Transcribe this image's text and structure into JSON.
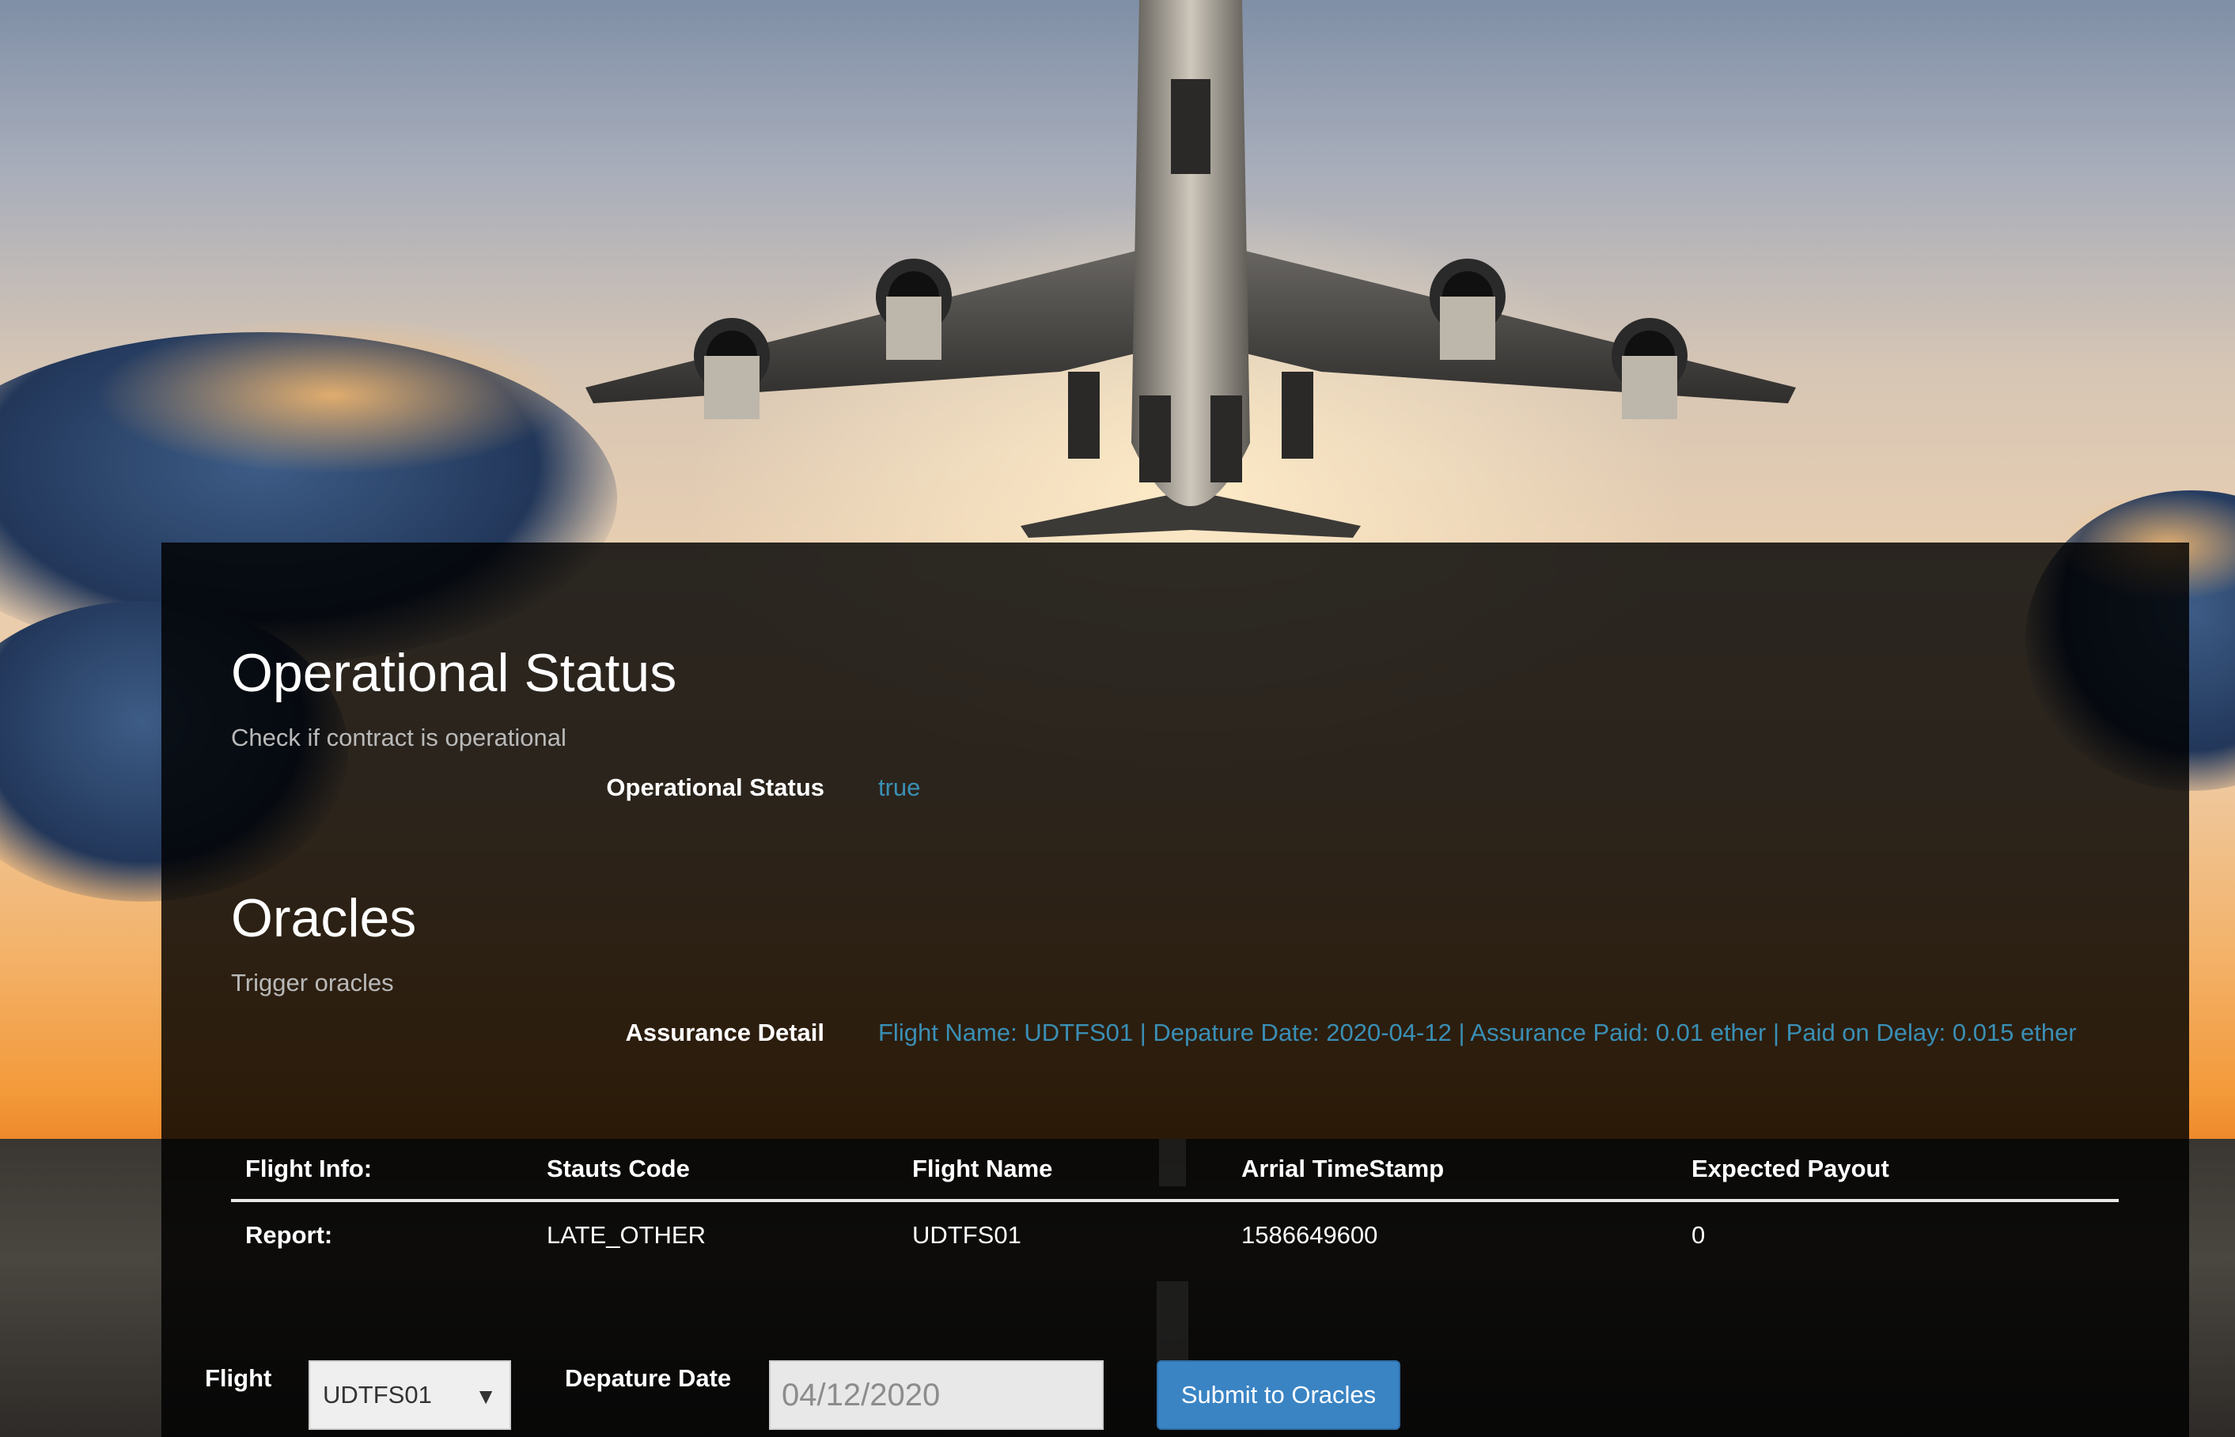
{
  "operational": {
    "title": "Operational Status",
    "subtitle": "Check if contract is operational",
    "label": "Operational Status",
    "value": "true"
  },
  "oracles": {
    "title": "Oracles",
    "subtitle": "Trigger oracles",
    "label": "Assurance Detail",
    "value": "Flight Name: UDTFS01 | Depature Date: 2020-04-12 | Assurance Paid: 0.01 ether | Paid on Delay: 0.015 ether"
  },
  "report_table": {
    "headers": [
      "Flight Info:",
      "Stauts Code",
      "Flight Name",
      "Arrial TimeStamp",
      "Expected Payout"
    ],
    "row": [
      "Report:",
      "LATE_OTHER",
      "UDTFS01",
      "1586649600",
      "0"
    ]
  },
  "form": {
    "flight_label": "Flight",
    "flight_selected": "UDTFS01",
    "date_label": "Depature Date",
    "date_value": "04/12/2020",
    "submit_label": "Submit to Oracles"
  },
  "colors": {
    "value_link": "#3a8fb5",
    "button": "#3a84c4"
  }
}
